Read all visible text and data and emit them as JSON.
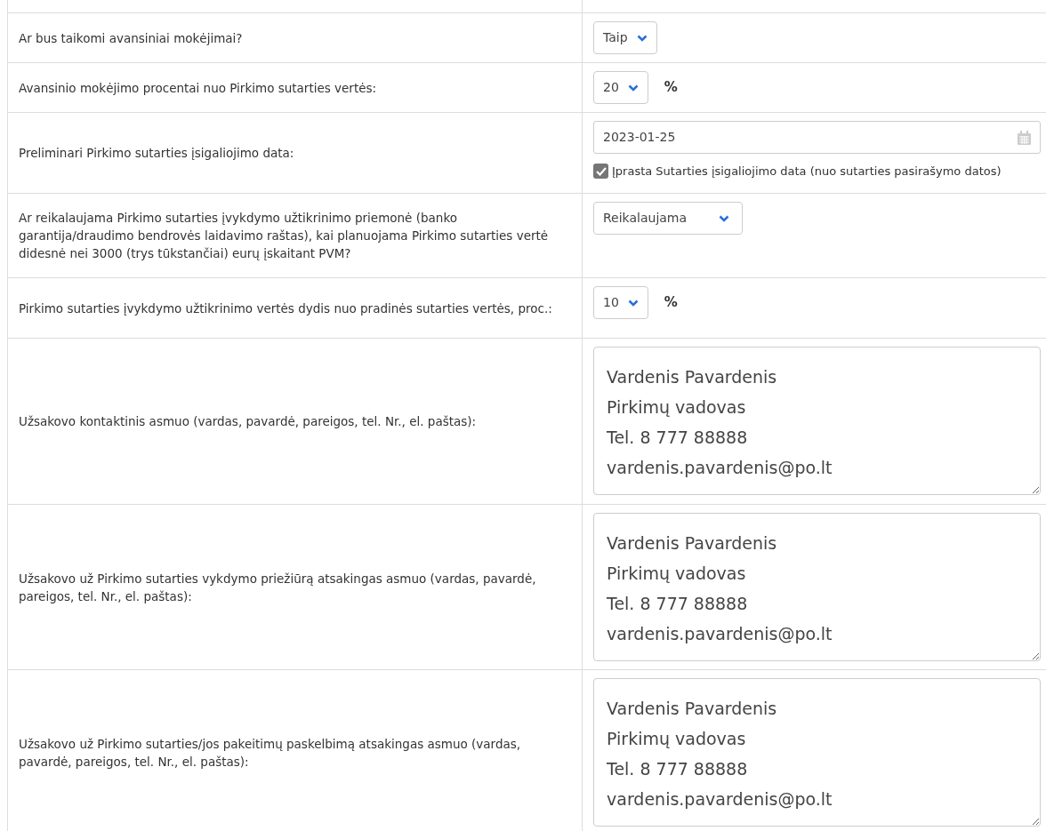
{
  "rows": [
    {
      "label": "Ar bus taikomi avansiniai mokėjimai?",
      "kind": "select",
      "value": "Taip"
    },
    {
      "label": "Avansinio mokėjimo procentai nuo Pirkimo sutarties vertės:",
      "kind": "select",
      "value": "20",
      "unit": "%"
    },
    {
      "label": "Preliminari Pirkimo sutarties įsigaliojimo data:",
      "kind": "date",
      "value": "2023-01-25",
      "checkbox": {
        "label": "Įprasta Sutarties įsigaliojimo data (nuo sutarties pasirašymo datos)",
        "checked": true
      }
    },
    {
      "label": "Ar reikalaujama Pirkimo sutarties įvykdymo užtikrinimo priemonė (banko garantija/draudimo bendrovės laidavimo raštas), kai planuojama Pirkimo sutarties vertė didesnė nei 3000 (trys tūkstančiai) eurų įskaitant PVM?",
      "kind": "select",
      "value": "Reikalaujama"
    },
    {
      "label": "Pirkimo sutarties įvykdymo užtikrinimo vertės dydis nuo pradinės sutarties vertės, proc.:",
      "kind": "select",
      "value": "10",
      "unit": "%"
    },
    {
      "label": "Užsakovo kontaktinis asmuo (vardas, pavardė, pareigos, tel. Nr., el. paštas):",
      "kind": "textarea",
      "value": "Vardenis Pavardenis\nPirkimų vadovas\nTel. 8 777 88888\nvardenis.pavardenis@po.lt"
    },
    {
      "label": "Užsakovo už Pirkimo sutarties vykdymo priežiūrą atsakingas asmuo (vardas, pavardė, pareigos, tel. Nr., el. paštas):",
      "kind": "textarea",
      "value": "Vardenis Pavardenis\nPirkimų vadovas\nTel. 8 777 88888\nvardenis.pavardenis@po.lt"
    },
    {
      "label": "Užsakovo už Pirkimo sutarties/jos pakeitimų paskelbimą atsakingas asmuo (vardas, pavardė, pareigos, tel. Nr., el. paštas):",
      "kind": "textarea",
      "value": "Vardenis Pavardenis\nPirkimų vadovas\nTel. 8 777 88888\nvardenis.pavardenis@po.lt"
    }
  ]
}
